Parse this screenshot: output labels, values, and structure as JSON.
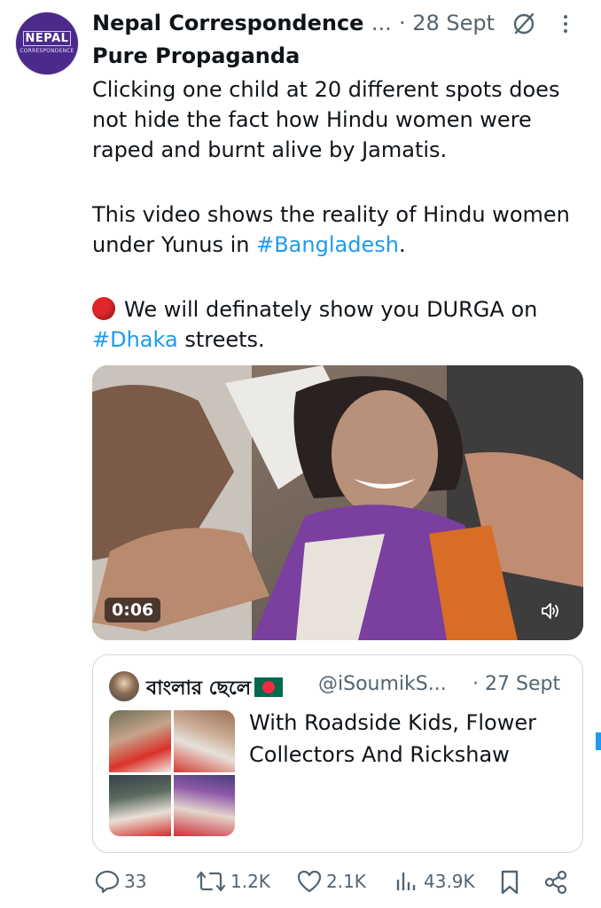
{
  "tweet": {
    "avatar": {
      "big": "NEPAL",
      "small": "CORRESPONDENCE"
    },
    "author_name": "Nepal Correspondence",
    "author_ellipsis": "...",
    "date": "· 28 Sept",
    "subtitle": "Pure Propaganda",
    "lines": {
      "l1": "Clicking one child at 20 different spots does",
      "l2": "not hide the fact how Hindu women were",
      "l3": "raped and burnt alive by Jamatis.",
      "l4": "This video shows the reality of Hindu women",
      "l5_pre": "under Yunus in ",
      "l5_tag": "#Bangladesh",
      "l5_post": ".",
      "l6": "We will definately show you DURGA on",
      "l7_tag": "#Dhaka",
      "l7_post": " streets."
    },
    "video": {
      "timecode": "0:06"
    }
  },
  "quote": {
    "name": "বাংলার ছেলে",
    "handle": "@iSoumikS...",
    "date": "· 27 Sept",
    "text_line1": "With Roadside Kids, Flower",
    "text_line2": "Collectors And Rickshaw"
  },
  "actions": {
    "replies": "33",
    "reposts": "1.2K",
    "likes": "2.1K",
    "views": "43.9K"
  },
  "colors": {
    "link": "#1d9bf0",
    "muted": "#536471",
    "text": "#0f1419"
  }
}
